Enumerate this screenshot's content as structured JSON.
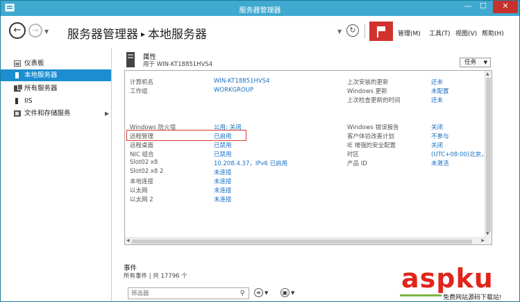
{
  "window": {
    "title": "服务器管理器",
    "controls": {
      "minimize": "—",
      "maximize": "☐",
      "close": "✕"
    }
  },
  "header": {
    "breadcrumb_root": "服务器管理器",
    "breadcrumb_sep": "▸",
    "breadcrumb_current": "本地服务器",
    "menus": [
      "管理(M)",
      "工具(T)",
      "视图(V)",
      "帮助(H)"
    ]
  },
  "sidebar": {
    "items": [
      {
        "label": "仪表板",
        "icon": "dashboard-icon"
      },
      {
        "label": "本地服务器",
        "icon": "local-server-icon",
        "active": true
      },
      {
        "label": "所有服务器",
        "icon": "all-servers-icon"
      },
      {
        "label": "IIS",
        "icon": "iis-icon"
      },
      {
        "label": "文件和存储服务",
        "icon": "file-storage-icon",
        "expandable": true
      }
    ]
  },
  "properties": {
    "title": "属性",
    "subtitle": "用于 WIN-KT18851HVS4",
    "tasks_label": "任务",
    "left": [
      {
        "label": "计算机名",
        "value": "WIN-KT18851HVS4"
      },
      {
        "label": "工作组",
        "value": "WORKGROUP"
      },
      {
        "label": "Windows 防火墙",
        "value": "公用: 关闭"
      },
      {
        "label": "远程管理",
        "value": "已启用"
      },
      {
        "label": "远程桌面",
        "value": "已禁用"
      },
      {
        "label": "NIC 组合",
        "value": "已禁用"
      },
      {
        "label": "Slot02 x8",
        "value": "10.208.4.37，IPv6 已启用"
      },
      {
        "label": "Slot02 x8 2",
        "value": "未连接"
      },
      {
        "label": "本地连接",
        "value": "未连接"
      },
      {
        "label": "以太网",
        "value": "未连接"
      },
      {
        "label": "以太网 2",
        "value": "未连接"
      }
    ],
    "right": [
      {
        "label": "上次安装的更新",
        "value": "还未"
      },
      {
        "label": "Windows 更新",
        "value": "未配置"
      },
      {
        "label": "上次检查更新的时间",
        "value": "还未"
      },
      {
        "label": "Windows 错误报告",
        "value": "关闭"
      },
      {
        "label": "客户体验改善计划",
        "value": "不参与"
      },
      {
        "label": "IE 增强的安全配置",
        "value": "关闭"
      },
      {
        "label": "时区",
        "value": "(UTC+08:00)北京，"
      },
      {
        "label": "产品 ID",
        "value": "未激活"
      }
    ]
  },
  "events": {
    "title": "事件",
    "subtitle": "所有事件 | 共 17796 个",
    "filter_placeholder": "筛选器"
  },
  "watermark": {
    "brand": "aspku",
    "tagline": "免费网站源码下载站!"
  },
  "colors": {
    "titlebar": "#3fa9cf",
    "accent": "#1b8dd0",
    "link": "#1a6fc1",
    "flag": "#d2322d",
    "highlight_box": "#d23a2a"
  }
}
